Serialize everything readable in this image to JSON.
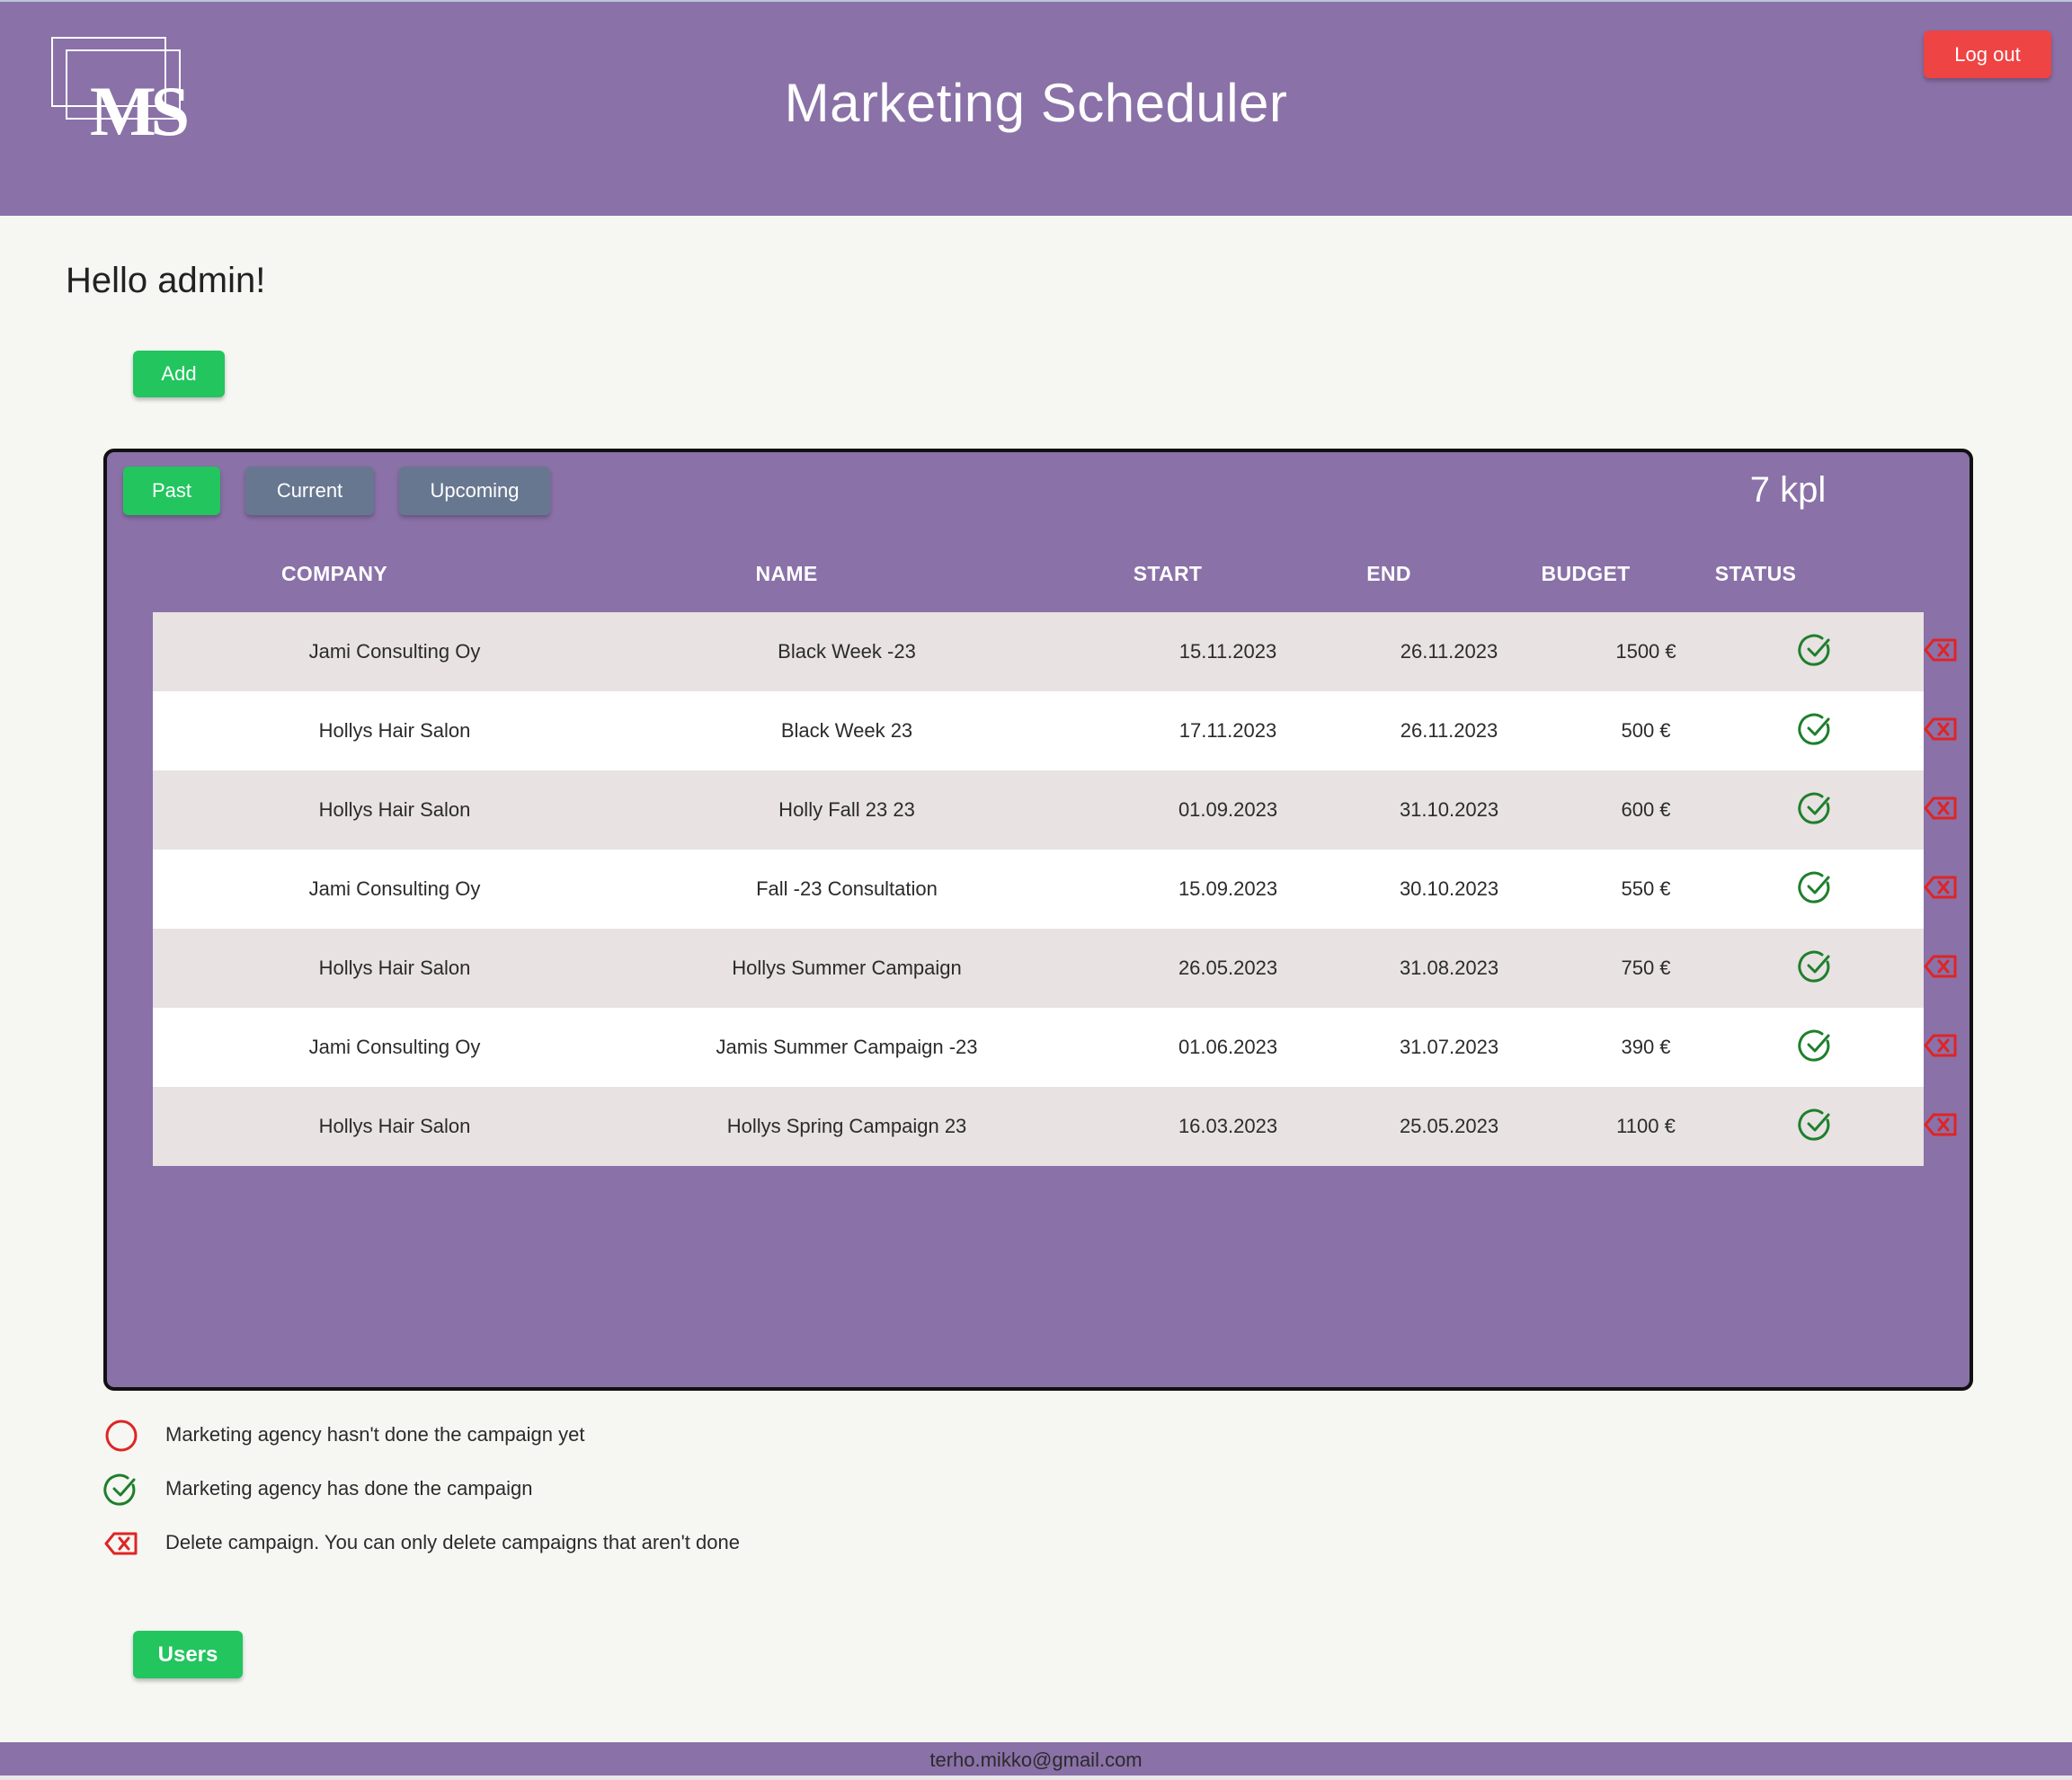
{
  "header": {
    "logo_text": "MS",
    "title": "Marketing Scheduler",
    "logout_label": "Log out"
  },
  "greeting": "Hello admin!",
  "add_label": "Add",
  "tabs": [
    {
      "label": "Past",
      "active": true
    },
    {
      "label": "Current",
      "active": false
    },
    {
      "label": "Upcoming",
      "active": false
    }
  ],
  "count_label": "7 kpl",
  "table": {
    "headers": [
      "COMPANY",
      "NAME",
      "START",
      "END",
      "BUDGET",
      "STATUS"
    ],
    "rows": [
      {
        "company": "Jami Consulting Oy",
        "name": "Black Week -23",
        "start": "15.11.2023",
        "end": "26.11.2023",
        "budget": "1500 €",
        "status": "done"
      },
      {
        "company": "Hollys Hair Salon",
        "name": "Black Week 23",
        "start": "17.11.2023",
        "end": "26.11.2023",
        "budget": "500 €",
        "status": "done"
      },
      {
        "company": "Hollys Hair Salon",
        "name": "Holly Fall 23 23",
        "start": "01.09.2023",
        "end": "31.10.2023",
        "budget": "600 €",
        "status": "done"
      },
      {
        "company": "Jami Consulting Oy",
        "name": "Fall -23 Consultation",
        "start": "15.09.2023",
        "end": "30.10.2023",
        "budget": "550 €",
        "status": "done"
      },
      {
        "company": "Hollys Hair Salon",
        "name": "Hollys Summer Campaign",
        "start": "26.05.2023",
        "end": "31.08.2023",
        "budget": "750 €",
        "status": "done"
      },
      {
        "company": "Jami Consulting Oy",
        "name": "Jamis Summer Campaign -23",
        "start": "01.06.2023",
        "end": "31.07.2023",
        "budget": "390 €",
        "status": "done"
      },
      {
        "company": "Hollys Hair Salon",
        "name": "Hollys Spring Campaign 23",
        "start": "16.03.2023",
        "end": "25.05.2023",
        "budget": "1100 €",
        "status": "done"
      }
    ]
  },
  "legend": [
    {
      "icon": "circle-icon",
      "text": "Marketing agency hasn't done the campaign yet"
    },
    {
      "icon": "check-circle-icon",
      "text": "Marketing agency has done the campaign"
    },
    {
      "icon": "delete-icon",
      "text": "Delete campaign. You can only delete campaigns that aren't done"
    }
  ],
  "users_label": "Users",
  "footer_email": "terho.mikko@gmail.com",
  "colors": {
    "brand_purple": "#8a71a8",
    "green": "#22c55e",
    "red": "#ee4444",
    "check_green": "#1e7f2c",
    "delete_red": "#e02424",
    "tab_inactive": "#687790"
  }
}
